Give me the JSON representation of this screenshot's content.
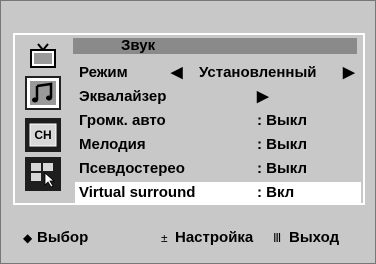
{
  "menu": {
    "title": "Звук",
    "items": [
      {
        "label": "Режим",
        "left_arrow": "◀",
        "value": "Установленный",
        "right_arrow": "▶"
      },
      {
        "label": "Эквалайзер",
        "value": "▶"
      },
      {
        "label": "Громк. авто",
        "value": ": Выкл"
      },
      {
        "label": "Мелодия",
        "value": ": Выкл"
      },
      {
        "label": "Псевдостерео",
        "value": ": Выкл"
      },
      {
        "label": "Virtual surround",
        "value": ": Вкл"
      }
    ]
  },
  "side_icons": [
    "tv-picture-icon",
    "music-note-icon",
    "channel-icon",
    "setup-icon"
  ],
  "side_icon_text": {
    "channel": "CH"
  },
  "footer": {
    "select_symbol": "◆",
    "select_label": "Выбор",
    "adjust_symbol": "±",
    "adjust_label": "Настройка",
    "exit_symbol": "Ⅲ",
    "exit_label": "Выход"
  },
  "colors": {
    "background": "#c8c8c8",
    "title_bar": "#8a8a8a",
    "highlight": "#ffffff"
  }
}
